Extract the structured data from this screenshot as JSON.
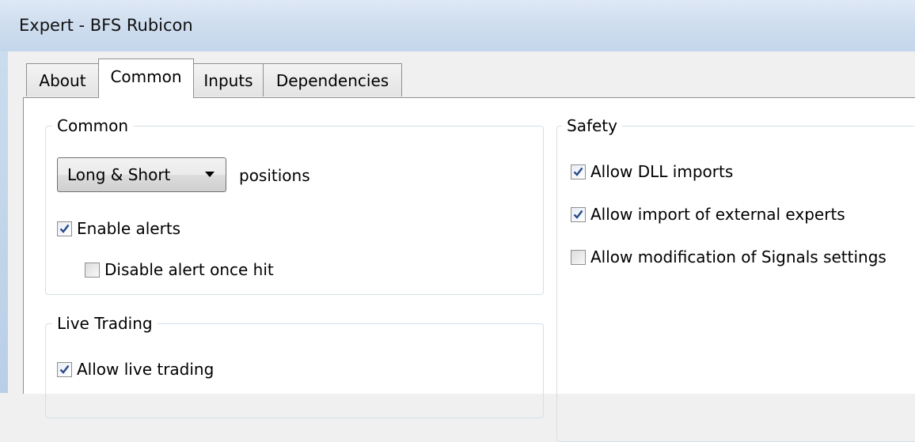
{
  "window": {
    "title": "Expert - BFS Rubicon"
  },
  "tabs": [
    {
      "label": "About",
      "active": false
    },
    {
      "label": "Common",
      "active": true
    },
    {
      "label": "Inputs",
      "active": false
    },
    {
      "label": "Dependencies",
      "active": false
    }
  ],
  "common_group": {
    "legend": "Common",
    "positions_select": {
      "value": "Long & Short"
    },
    "positions_label": "positions",
    "enable_alerts": {
      "label": "Enable alerts",
      "checked": true
    },
    "disable_alert_once_hit": {
      "label": "Disable alert once hit",
      "checked": false
    }
  },
  "live_group": {
    "legend": "Live Trading",
    "allow_live_trading": {
      "label": "Allow live trading",
      "checked": true
    }
  },
  "safety_group": {
    "legend": "Safety",
    "allow_dll_imports": {
      "label": "Allow DLL imports",
      "checked": true
    },
    "allow_import_external": {
      "label": "Allow import of external experts",
      "checked": true
    },
    "allow_modification_signals": {
      "label": "Allow modification of Signals settings",
      "checked": false
    }
  },
  "colors": {
    "check_mark": "#2a4b8d",
    "title_bar": "#cfdeef",
    "panel": "#ffffff"
  }
}
